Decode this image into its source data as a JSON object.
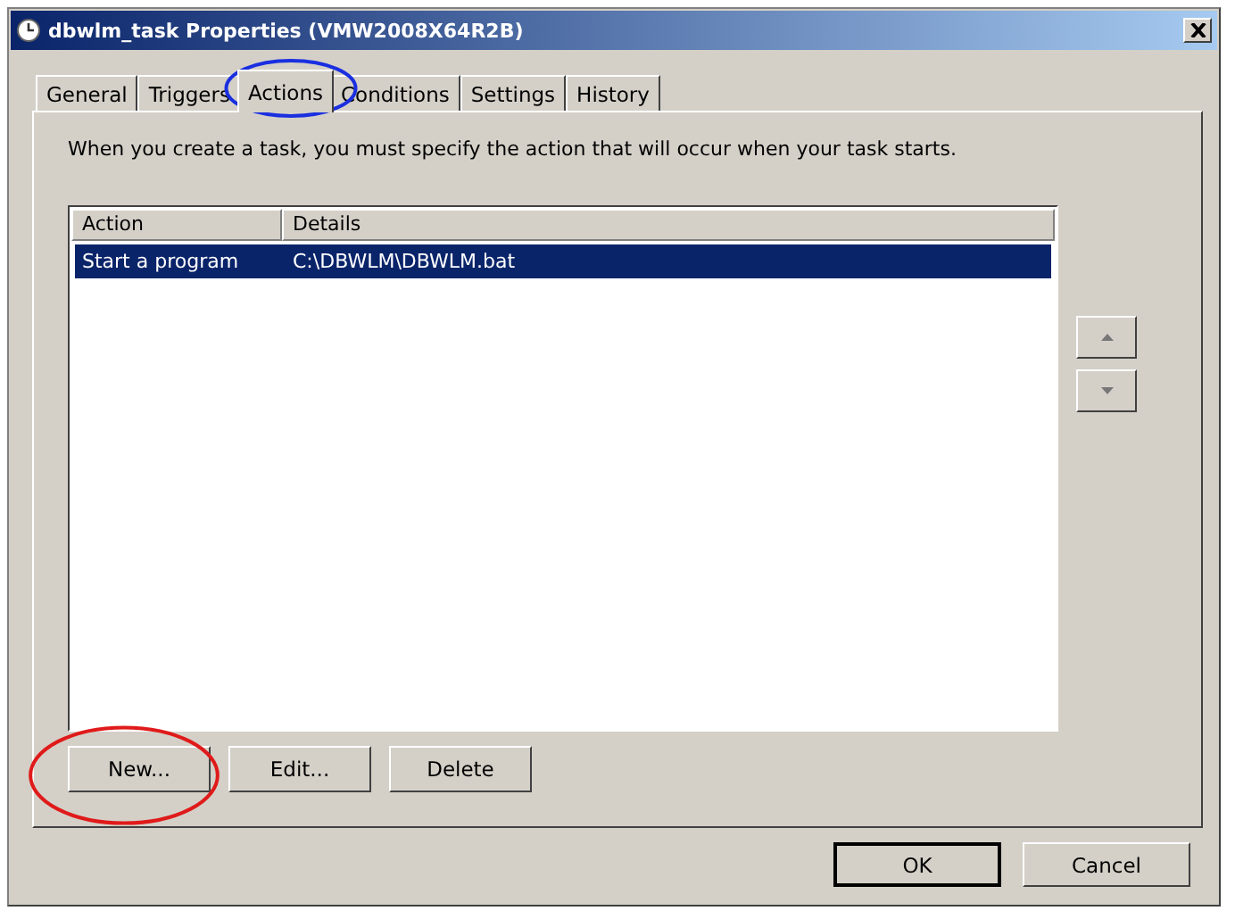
{
  "window": {
    "title": "dbwlm_task Properties (VMW2008X64R2B)"
  },
  "tabs": [
    {
      "label": "General",
      "selected": false
    },
    {
      "label": "Triggers",
      "selected": false
    },
    {
      "label": "Actions",
      "selected": true
    },
    {
      "label": "Conditions",
      "selected": false
    },
    {
      "label": "Settings",
      "selected": false
    },
    {
      "label": "History",
      "selected": false
    }
  ],
  "description": "When you create a task, you must specify the action that will occur when your task starts.",
  "table": {
    "columns": [
      "Action",
      "Details"
    ],
    "rows": [
      {
        "cells": [
          "Start a program",
          "C:\\DBWLM\\DBWLM.bat"
        ],
        "selected": true
      }
    ]
  },
  "action_buttons": [
    "New...",
    "Edit...",
    "Delete"
  ],
  "dialog_buttons": [
    {
      "label": "OK",
      "default": true
    },
    {
      "label": "Cancel",
      "default": false
    }
  ],
  "annotations": [
    {
      "color": "#1a2fe0"
    },
    {
      "color": "#e01a1a"
    }
  ]
}
